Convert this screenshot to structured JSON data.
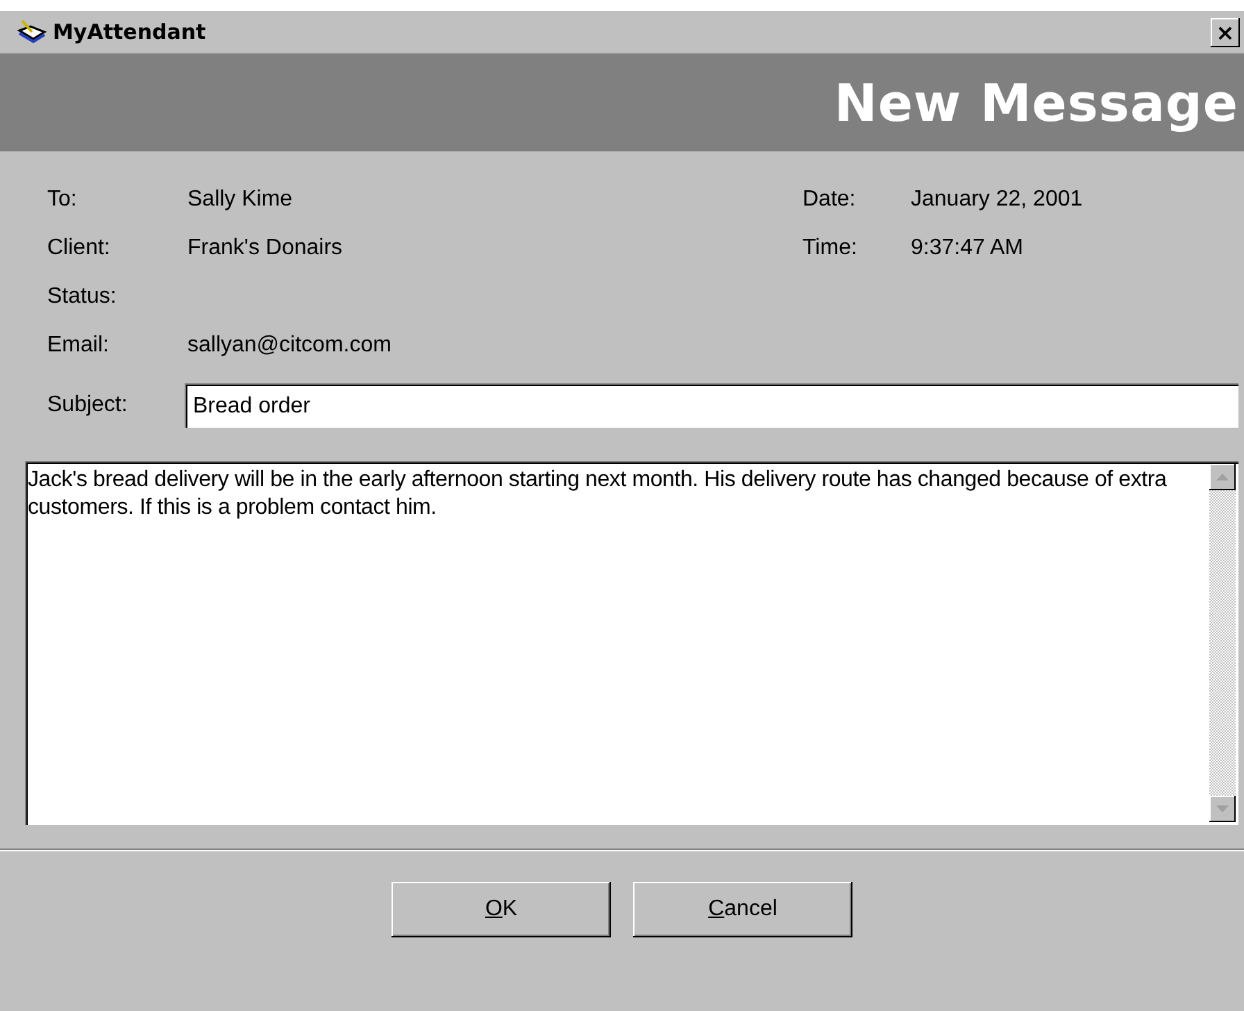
{
  "window": {
    "title": "MyAttendant",
    "close": "×"
  },
  "header": {
    "title": "New Message"
  },
  "fields_left": [
    {
      "label": "To:",
      "value": "Sally Kime"
    },
    {
      "label": "Client:",
      "value": "Frank's Donairs"
    },
    {
      "label": "Status:"
    },
    {
      "label": "Email:",
      "value": "sallyan@citcom.com"
    }
  ],
  "fields_right": [
    {
      "label": "Date:",
      "value": "January 22, 2001"
    },
    {
      "label": "Time:",
      "value": "9:37:47 AM"
    }
  ],
  "subject": {
    "label": "Subject:",
    "value": "Bread order"
  },
  "message": {
    "value": "Jack's bread delivery will be in the early afternoon starting next month. His delivery route has changed because of extra customers. If this is a problem contact him."
  },
  "buttons": [
    {
      "key": "O",
      "rest": "K"
    },
    {
      "key": "C",
      "rest": "ancel"
    }
  ]
}
